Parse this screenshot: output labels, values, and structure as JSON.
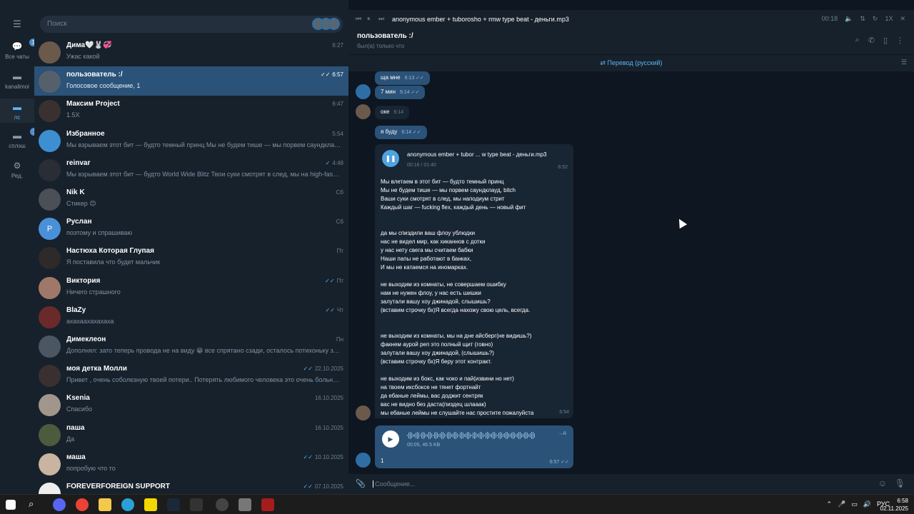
{
  "rail": [
    {
      "label": "Все чаты",
      "badge": "128"
    },
    {
      "label": "kanalimoi",
      "badge": ""
    },
    {
      "label": "лс",
      "badge": ""
    },
    {
      "label": "сплэш",
      "badge": "128"
    },
    {
      "label": "Ред.",
      "badge": ""
    }
  ],
  "search": {
    "placeholder": "Поиск"
  },
  "chats": [
    {
      "name": "Дима🤍🐰💞",
      "preview": "Ужас какой",
      "time": "6:27",
      "ticks": "",
      "color": "#6b5a4c"
    },
    {
      "name": "пользователь :/",
      "preview": "Голосовое сообщение, 1",
      "time": "6:57",
      "ticks": "✓✓",
      "color": "#55606b"
    },
    {
      "name": "Максим Project",
      "preview": "1.5X",
      "time": "6:47",
      "ticks": "",
      "color": "#3a3030"
    },
    {
      "name": "Избранное",
      "preview": "Мы взрываем этот бит — будто темный принц Мы не будем тише — мы порвем саундклау...",
      "time": "5:54",
      "ticks": "",
      "color": "#3d8fd1"
    },
    {
      "name": "reinvar",
      "preview": "Мы взрываем этот бит — будто World Wide Blitz Твои суки смотрят в след, мы на high-fashio...",
      "time": "4:48",
      "ticks": "✓",
      "color": "#2a2d36"
    },
    {
      "name": "Nik K",
      "preview": "Стикер 😊",
      "time": "Сб",
      "ticks": "",
      "color": "#4a5055",
      "hl": true
    },
    {
      "name": "Руслан",
      "preview": "поэтому и спрашиваю",
      "time": "Сб",
      "ticks": "",
      "color": "#4a90d9",
      "letter": "Р"
    },
    {
      "name": "Настюха Которая Глупая",
      "preview": "Я поставила что будет мальчик",
      "time": "Пт",
      "ticks": "",
      "color": "#2e2a2a"
    },
    {
      "name": "Виктория",
      "preview": "Ничего страшного",
      "time": "Пт",
      "ticks": "✓✓",
      "color": "#a0786a"
    },
    {
      "name": "BlaZy",
      "preview": "ахахаахахахаха",
      "time": "Чт",
      "ticks": "✓✓",
      "color": "#6a2a2a"
    },
    {
      "name": "Димеклеон",
      "preview": "Дополнял: зато теперь провода не на виду 😁 все спрятано сзади, осталось потихоньку за...",
      "time": "Пн",
      "ticks": "",
      "color": "#4a5662"
    },
    {
      "name": "моя детка Молли",
      "preview": "Привет , очень соболезную твоей потери.. Потерять любимого человека это очень больно...",
      "time": "22.10.2025",
      "ticks": "✓✓",
      "color": "#3a3030"
    },
    {
      "name": "Ksenia",
      "preview": "Спасибо",
      "time": "16.10.2025",
      "ticks": "",
      "color": "#a0968c"
    },
    {
      "name": "паша",
      "preview": "Да",
      "time": "16.10.2025",
      "ticks": "",
      "color": "#4c5a3e"
    },
    {
      "name": "маша",
      "preview": "попробую что то",
      "time": "10.10.2025",
      "ticks": "✓✓",
      "color": "#c8b4a0"
    },
    {
      "name": "FOREVERFOREIGN SUPPORT",
      "preview": "",
      "time": "07.10.2025",
      "ticks": "✓✓",
      "color": "#eeeeee"
    }
  ],
  "player": {
    "title": "anonymous ember + tuborosho + rmw type beat - деньги.mp3",
    "time": "00:18"
  },
  "header": {
    "name": "пользователь :/",
    "status": "был(а) только что"
  },
  "translate": "Перевод (русский)",
  "messages": [
    {
      "text": "ща мне",
      "time": "6:13",
      "out": true
    },
    {
      "text": "7 мин",
      "time": "6:14",
      "out": true
    },
    {
      "text": "оке",
      "time": "6:14",
      "out": false
    },
    {
      "text": "я буду",
      "time": "6:14",
      "out": true
    }
  ],
  "music": {
    "title": "anonymous ember + tubor  ...  w type beat - деньги.mp3",
    "progress": "00:18 / 01:40",
    "time": "6:52"
  },
  "lyrics": {
    "lines": [
      "Мы влетаем в этот бит — будто темный принц",
      "Мы не будем тише — мы порвем саундклауд, bitch",
      "Ваши суки смотрят в след, мы наподиум стрит",
      "Каждый шаг — fucking flex, каждый день — новый фит",
      "",
      "",
      "да мы спиздили ваш флоу ублюдки",
      "нас не видел мир, как хиканнов с дотки",
      "у нас нету свега мы считаем бабки",
      "Наши папы не работают в банках,",
      "И мы не катаемся на иномарках.",
      "",
      "не выходим из комнаты, не совершаем ошибку",
      "нам не нужен флоу, у нас есть шишки",
      "залутали вашу хоу джинадой, слышишь?",
      "(вставим строчку бх)Я всегда нахожу свою цель, всегда.",
      "",
      "",
      "не выходим из комнаты, мы на дне айсберг(не видишь?)",
      "факнем  аурой реп это полный щит (говно)",
      "залутали вашу хоу джинадой, (слышишь?)",
      "(вставим строчку бх)Я беру этот контракт.",
      "",
      "не выходим из бокс, как чоко и пай(извини но нет)",
      "на твоем иксбоксе не тянет фортнайт",
      "да ебаные леймы, вас доджит сентряк",
      "вас не видно без даста(пиздец шлааак)",
      "мы ебаные леймы не слушайте нас простите пожалуйста"
    ],
    "time": "6:54"
  },
  "voice": {
    "stats": "00:05, 46.5 KB",
    "ta": "→A",
    "caption": "1",
    "time": "6:57"
  },
  "compose": {
    "placeholder": "Сообщение..."
  },
  "taskbar": {
    "lang": "РУС",
    "time": "6:58",
    "date": "02.11.2025"
  }
}
